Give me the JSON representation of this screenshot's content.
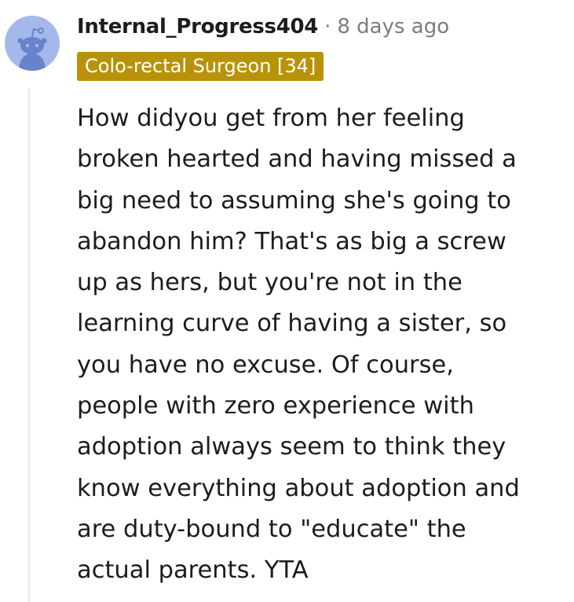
{
  "comment": {
    "username": "Internal_Progress404",
    "separator": "·",
    "timestamp": "8 days ago",
    "flair": "Colo-rectal Surgeon [34]",
    "body": "How didyou get from her feeling\nbroken hearted and having missed a\nbig need to assuming she's going to\nabandon him? That's as big a screw\nup as hers, but you're not in the\nlearning curve of having a sister, so\nyou have no excuse.  Of course,\npeople with zero experience with\nadoption always seem to think they\nknow everything about adoption and\nare duty-bound to \"educate\" the\nactual parents.  YTA"
  },
  "colors": {
    "avatar_bg": "#a5b8eb",
    "flair_bg": "#b8930a",
    "thread_line": "#edeff1",
    "muted_text": "#7c7c7c"
  },
  "icons": {
    "avatar": "snoo-avatar-icon"
  }
}
